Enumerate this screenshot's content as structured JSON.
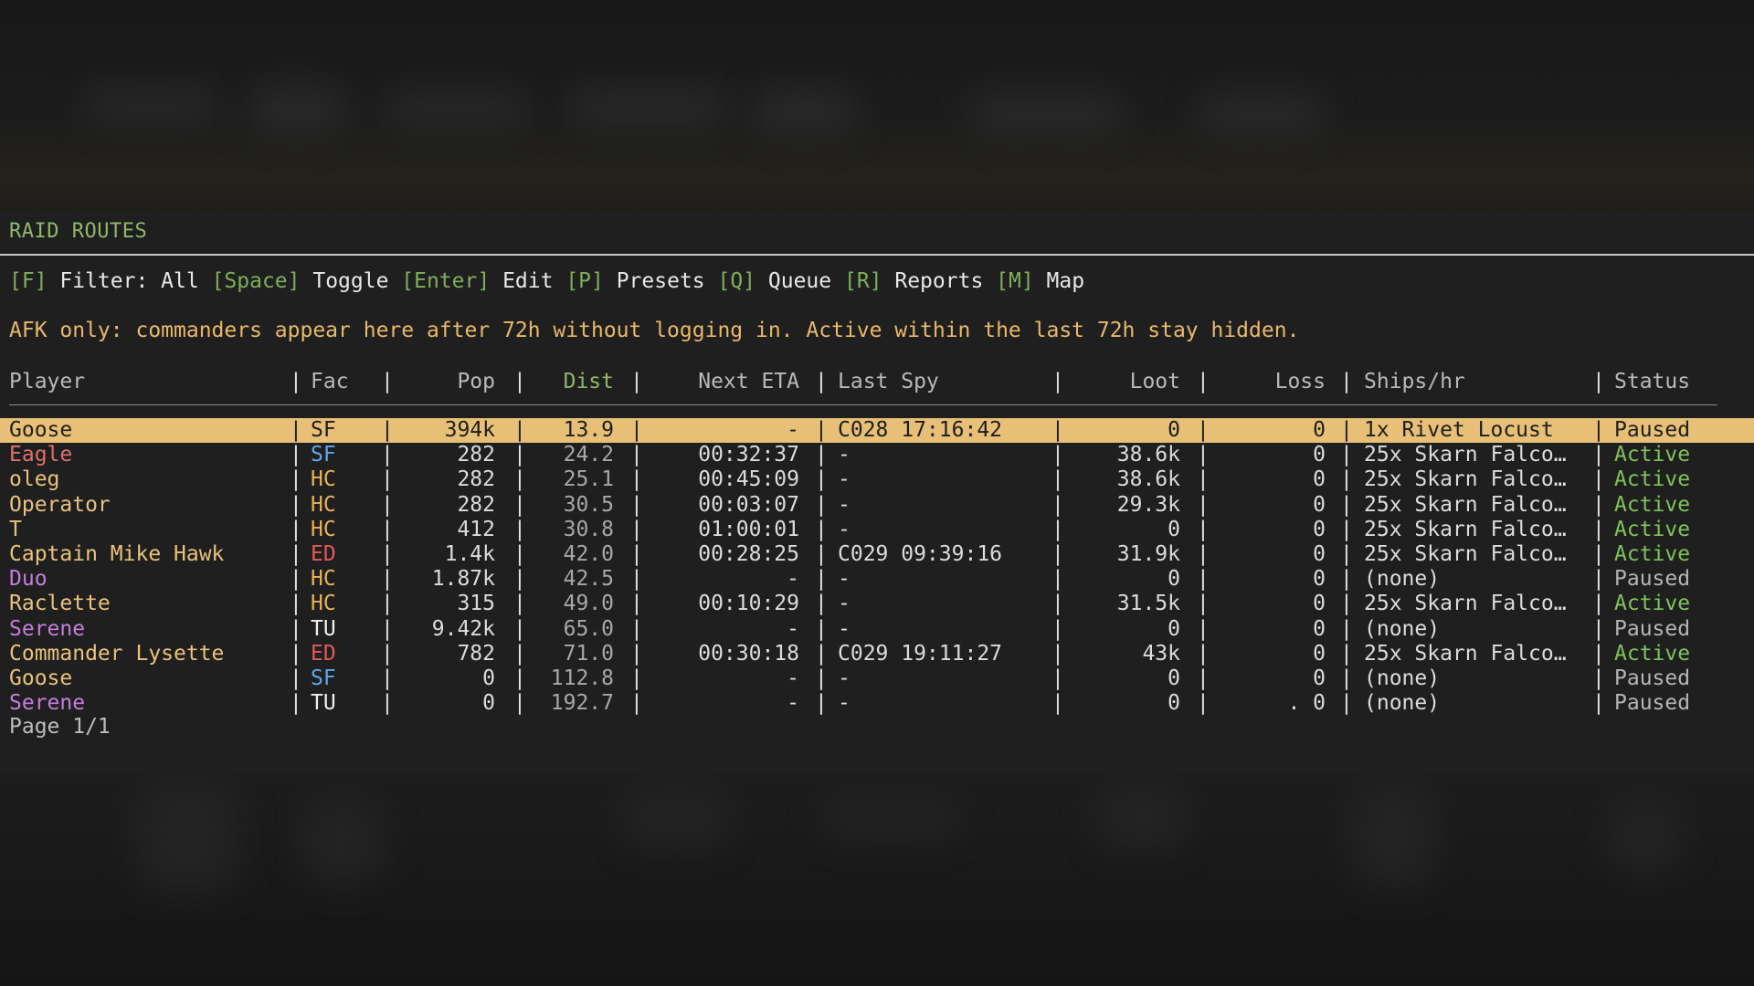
{
  "panel": {
    "title": "RAID ROUTES",
    "keys": [
      {
        "key": "[F]",
        "label": " Filter: All "
      },
      {
        "key": "[Space]",
        "label": " Toggle "
      },
      {
        "key": "[Enter]",
        "label": " Edit "
      },
      {
        "key": "[P]",
        "label": " Presets "
      },
      {
        "key": "[Q]",
        "label": " Queue "
      },
      {
        "key": "[R]",
        "label": " Reports "
      },
      {
        "key": "[M]",
        "label": " Map"
      }
    ],
    "note": "AFK only: commanders appear here after 72h without logging in. Active within the last 72h stay hidden.",
    "footer": "Page 1/1"
  },
  "colors": {
    "player": "#e9c27b",
    "player_red": "#e0706a",
    "player_purple": "#c77ddb",
    "fac_sf": "#5fa8e8",
    "fac_hc": "#e6b25a",
    "fac_ed": "#e05a5a",
    "fac_tu": "#f0f0f0",
    "status_active": "#7fc35a",
    "status_paused": "#b5b5b5",
    "selected_bg": "#e8bf76"
  },
  "table": {
    "headers": {
      "player": "Player",
      "fac": "Fac",
      "pop": "Pop",
      "dist": "Dist",
      "eta": "Next ETA",
      "spy": "Last Spy",
      "loot": "Loot",
      "loss": "Loss",
      "ships": "Ships/hr",
      "status": "Status"
    },
    "rows": [
      {
        "player": "Goose",
        "player_color": "player",
        "fac": "SF",
        "fac_color": "fac_sf",
        "pop": "394k",
        "dist": "13.9",
        "eta": "-",
        "spy": "C028 17:16:42",
        "loot": "0",
        "loss": "0",
        "ships": "1x Rivet Locust",
        "status": "Paused",
        "selected": true
      },
      {
        "player": "Eagle",
        "player_color": "player_red",
        "fac": "SF",
        "fac_color": "fac_sf",
        "pop": "282",
        "dist": "24.2",
        "eta": "00:32:37",
        "spy": "-",
        "loot": "38.6k",
        "loss": "0",
        "ships": "25x Skarn Falco…",
        "status": "Active"
      },
      {
        "player": "oleg",
        "player_color": "player",
        "fac": "HC",
        "fac_color": "fac_hc",
        "pop": "282",
        "dist": "25.1",
        "eta": "00:45:09",
        "spy": "-",
        "loot": "38.6k",
        "loss": "0",
        "ships": "25x Skarn Falco…",
        "status": "Active"
      },
      {
        "player": "Operator",
        "player_color": "player",
        "fac": "HC",
        "fac_color": "fac_hc",
        "pop": "282",
        "dist": "30.5",
        "eta": "00:03:07",
        "spy": "-",
        "loot": "29.3k",
        "loss": "0",
        "ships": "25x Skarn Falco…",
        "status": "Active"
      },
      {
        "player": "T",
        "player_color": "player",
        "fac": "HC",
        "fac_color": "fac_hc",
        "pop": "412",
        "dist": "30.8",
        "eta": "01:00:01",
        "spy": "-",
        "loot": "0",
        "loss": "0",
        "ships": "25x Skarn Falco…",
        "status": "Active"
      },
      {
        "player": "Captain Mike Hawk",
        "player_color": "player",
        "fac": "ED",
        "fac_color": "fac_ed",
        "pop": "1.4k",
        "dist": "42.0",
        "eta": "00:28:25",
        "spy": "C029 09:39:16",
        "loot": "31.9k",
        "loss": "0",
        "ships": "25x Skarn Falco…",
        "status": "Active"
      },
      {
        "player": "Duo",
        "player_color": "player_purple",
        "fac": "HC",
        "fac_color": "fac_hc",
        "pop": "1.87k",
        "dist": "42.5",
        "eta": "-",
        "spy": "-",
        "loot": "0",
        "loss": "0",
        "ships": "(none)",
        "status": "Paused"
      },
      {
        "player": "Raclette",
        "player_color": "player",
        "fac": "HC",
        "fac_color": "fac_hc",
        "pop": "315",
        "dist": "49.0",
        "eta": "00:10:29",
        "spy": "-",
        "loot": "31.5k",
        "loss": "0",
        "ships": "25x Skarn Falco…",
        "status": "Active"
      },
      {
        "player": "Serene",
        "player_color": "player_purple",
        "fac": "TU",
        "fac_color": "fac_tu",
        "pop": "9.42k",
        "dist": "65.0",
        "eta": "-",
        "spy": "-",
        "loot": "0",
        "loss": "0",
        "ships": "(none)",
        "status": "Paused"
      },
      {
        "player": "Commander Lysette",
        "player_color": "player",
        "fac": "ED",
        "fac_color": "fac_ed",
        "pop": "782",
        "dist": "71.0",
        "eta": "00:30:18",
        "spy": "C029 19:11:27",
        "loot": "43k",
        "loss": "0",
        "ships": "25x Skarn Falco…",
        "status": "Active"
      },
      {
        "player": "Goose",
        "player_color": "player",
        "fac": "SF",
        "fac_color": "fac_sf",
        "pop": "0",
        "dist": "112.8",
        "eta": "-",
        "spy": "-",
        "loot": "0",
        "loss": "0",
        "ships": "(none)",
        "status": "Paused"
      },
      {
        "player": "Serene",
        "player_color": "player_purple",
        "fac": "TU",
        "fac_color": "fac_tu",
        "pop": "0",
        "dist": "192.7",
        "eta": "-",
        "spy": "-",
        "loot": "0",
        "loss": ". 0",
        "ships": "(none)",
        "status": "Paused"
      }
    ]
  }
}
